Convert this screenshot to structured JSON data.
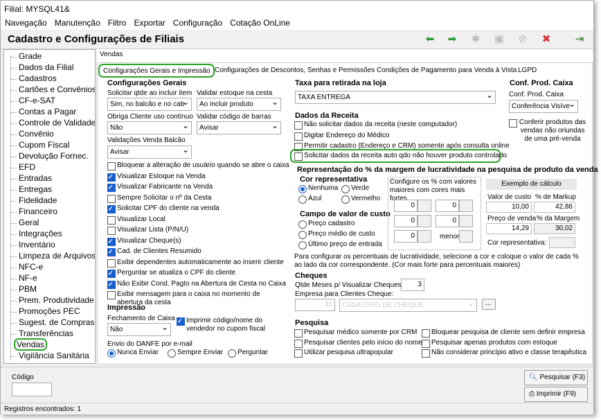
{
  "window": {
    "title": "Filial: MYSQL41&"
  },
  "menu": [
    "Navegação",
    "Manutenção",
    "Filtro",
    "Exportar",
    "Configuração",
    "Cotação OnLine"
  ],
  "header": {
    "title": "Cadastro e Configurações de Filiais"
  },
  "sidebar": [
    "Grade",
    "Dados da Filial",
    "Cadastros",
    "Cartões e Convênios",
    "CF-e-SAT",
    "Contas a Pagar",
    "Controle de Validade",
    "Convênio",
    "Cupom Fiscal",
    "Devolução Fornec.",
    "EFD",
    "Entradas",
    "Entregas",
    "Fidelidade",
    "Financeiro",
    "Geral",
    "Integrações",
    "Inventário",
    "Limpeza de Arquivos",
    "NFC-e",
    "NF-e",
    "PBM",
    "Prem. Produtividade",
    "Promoções PEC",
    "Sugest. de Compras",
    "Transferências",
    "Vendas",
    "Vigilância Sanitária"
  ],
  "top_tab": "Vendas",
  "tabs": [
    "Configurações Gerais e Impressão",
    "Configurações de Descontos, Senhas e Permissões",
    "Condições de Pagamento para Venda à Vista",
    "LGPD"
  ],
  "cg": {
    "title": "Configurações Gerais",
    "solicitar_qtde_label": "Solicitar qtde ao incluir item",
    "solicitar_qtde_value": "Sim, no balcão e no cab",
    "validar_estoque_label": "Validar estoque na cesta",
    "validar_estoque_value": "Ao incluir produto",
    "obriga_cliente_label": "Obriga Cliente uso contínuo",
    "obriga_cliente_value": "Não",
    "validar_codbar_label": "Validar código de barras",
    "validar_codbar_value": "Avisar",
    "validacoes_label": "Validações Venda Balcão",
    "validacoes_value": "Avisar"
  },
  "checks": [
    {
      "label": "Bloquear a alteração de usuário quando se abre o caixa",
      "on": false
    },
    {
      "label": "Visualizar Estoque na Venda",
      "on": true
    },
    {
      "label": "Visualizar Fabricante na Venda",
      "on": true
    },
    {
      "label": "Sempre Solicitar o nº da Cesta",
      "on": false
    },
    {
      "label": "Solicitar CPF do cliente na venda",
      "on": true
    },
    {
      "label": "Visualizar Local",
      "on": false
    },
    {
      "label": "Visualizar Lista (P/N/U)",
      "on": false
    },
    {
      "label": "Visualizar Cheque(s)",
      "on": true
    },
    {
      "label": "Cad. de Clientes Resumido",
      "on": true
    },
    {
      "label": "Exibir dependentes automaticamente ao inserir cliente",
      "on": false
    },
    {
      "label": "Perguntar se atualiza o CPF do cliente",
      "on": true
    },
    {
      "label": "Não Exibir Cond. Pagto na Abertura de Cesta no Caixa",
      "on": true
    },
    {
      "label": "Exibir mensagem para o caixa no momento de abertura da cesta",
      "on": false
    }
  ],
  "impressao": {
    "title": "Impressão",
    "fechamento_label": "Fechamento de Caixa",
    "fechamento_value": "Não",
    "imprimir_label": "Imprimir código/nome do vendedor no cupom fiscal"
  },
  "danfe": {
    "label": "Envio do DANFE por e-mail",
    "options": [
      "Nunca Enviar",
      "Sempre Enviar",
      "Perguntar"
    ]
  },
  "taxa": {
    "title": "Taxa para retirada na loja",
    "value": "TAXA ENTREGA"
  },
  "receita": {
    "title": "Dados da Receita",
    "items": [
      {
        "label": "Não solicitar dados da receita (neste computador)",
        "on": false
      },
      {
        "label": "Digitar Endereço do Médico",
        "on": false
      },
      {
        "label": "Permitir cadastro (Endereço e CRM) somente após consulta online",
        "on": false
      },
      {
        "label": "Solicitar dados da receita auto qdo não houver produto controlado",
        "on": false
      }
    ]
  },
  "conf_prod": {
    "title": "Conf. Prod. Caixa",
    "label": "Conf. Prod. Caixa",
    "value": "Conferência Visíve",
    "check_label": "Conferir produtos das vendas não oriundas de uma pré-venda"
  },
  "margem": {
    "title": "Representação do % da margem de lucratividade na pesquisa de produto da venda",
    "cor_title": "Cor representativa",
    "cores": [
      "Nenhuma",
      "Verde",
      "Azul",
      "Vermelho"
    ],
    "config_label": "Configure os % com valores maiores com cores mais fortes",
    "campo_title": "Campo de valor de custo",
    "campos": [
      "Preço cadastro",
      "Preço médio de custo",
      "Último preço de entrada"
    ],
    "col1": [
      "0",
      "0",
      "0"
    ],
    "col2": [
      "0",
      "0"
    ],
    "menor": "menor",
    "exemplo_title": "Exemplo de cálculo",
    "valor_custo_label": "Valor de custo",
    "markup_label": "% de Markup",
    "valor_custo": "10,00",
    "markup": "42,86",
    "preco_venda_label": "Preço de venda",
    "margem_label": "% da Margem",
    "preco_venda": "14,29",
    "margem": "30,02",
    "cor_rep_label": "Cor representativa:",
    "note": "Para configurar os percentuais de lucratividade, selecione a cor e coloque o valor de cada % ao lado da cor correspondente. (Cor mais forte para percentuais maiores)"
  },
  "cheques": {
    "title": "Cheques",
    "qtde_label": "Qtde Meses p/ Visualizar Cheques:",
    "qtde_value": "3",
    "empresa_label": "Empresa para Clientes Cheque:",
    "empresa_code": "31",
    "empresa_name": "CADASTRO DE CHEQUE",
    "more": "..."
  },
  "pesquisa": {
    "title": "Pesquisa",
    "items": [
      "Pesquisar médico somente por CRM",
      "Bloquear pesquisa de cliente sem definir empresa",
      "Pesquisar clientes pelo início do nome",
      "Pesquisar apenas produtos com estoque",
      "Utilizar pesquisa ultrapopular",
      "Não considerar princípio ativo e classe terapêutica"
    ]
  },
  "bottom": {
    "codigo_label": "Código",
    "pesquisar": "Pesquisar (F3)",
    "imprimir": "Imprimir (F9)"
  },
  "status": "Registros encontrados: 1",
  "colors": {
    "highlight": "#2aa52a",
    "check": "#1a5fd0"
  }
}
